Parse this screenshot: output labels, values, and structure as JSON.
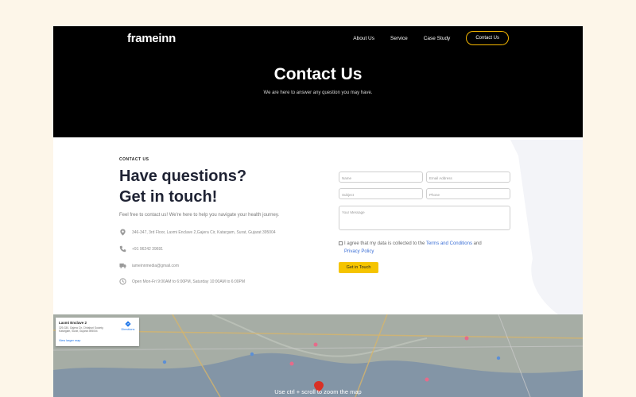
{
  "brand": {
    "logo": "frameinn",
    "accent": "#f5b700"
  },
  "nav": {
    "items": [
      "About Us",
      "Service",
      "Case Study"
    ],
    "cta": "Contact Us"
  },
  "hero": {
    "title": "Contact Us",
    "subtitle": "We are here to answer any question you may have."
  },
  "contact": {
    "eyebrow": "CONTACT US",
    "heading_line1": "Have questions?",
    "heading_line2": "Get in touch!",
    "lead": "Feel free to contact us! We're here to help you navigate your health journey.",
    "address": "346-347, 3rd Floor, Laxmi Enclave 2,Gajera Cir, Katargam, Surat, Gujarat 395004",
    "phone": "+91 96242 39691",
    "email": "iameinnmedia@gmail.com",
    "hours": "Open Mon-Fri 9:00AM to 6:00PM, Saturday 10:00AM to 6:00PM"
  },
  "form": {
    "name_placeholder": "Name",
    "email_placeholder": "Email Address",
    "subject_placeholder": "Subject",
    "phone_placeholder": "Phone",
    "message_placeholder": "Your Message",
    "consent_prefix": "I agree that my data is collected to the ",
    "consent_link1": "Terms and Conditions",
    "consent_and": " and",
    "consent_link2": "Privacy Policy",
    "submit_label": "Get in Touch"
  },
  "map": {
    "place_title": "Laxmi Enclave 2",
    "place_address": "329-330, Gajera Cir, Chhaburi Society, Katargam, Surat, Gujarat 395004",
    "directions_label": "Directions",
    "larger_map_label": "View larger map",
    "hint": "Use ctrl + scroll to zoom the map"
  }
}
